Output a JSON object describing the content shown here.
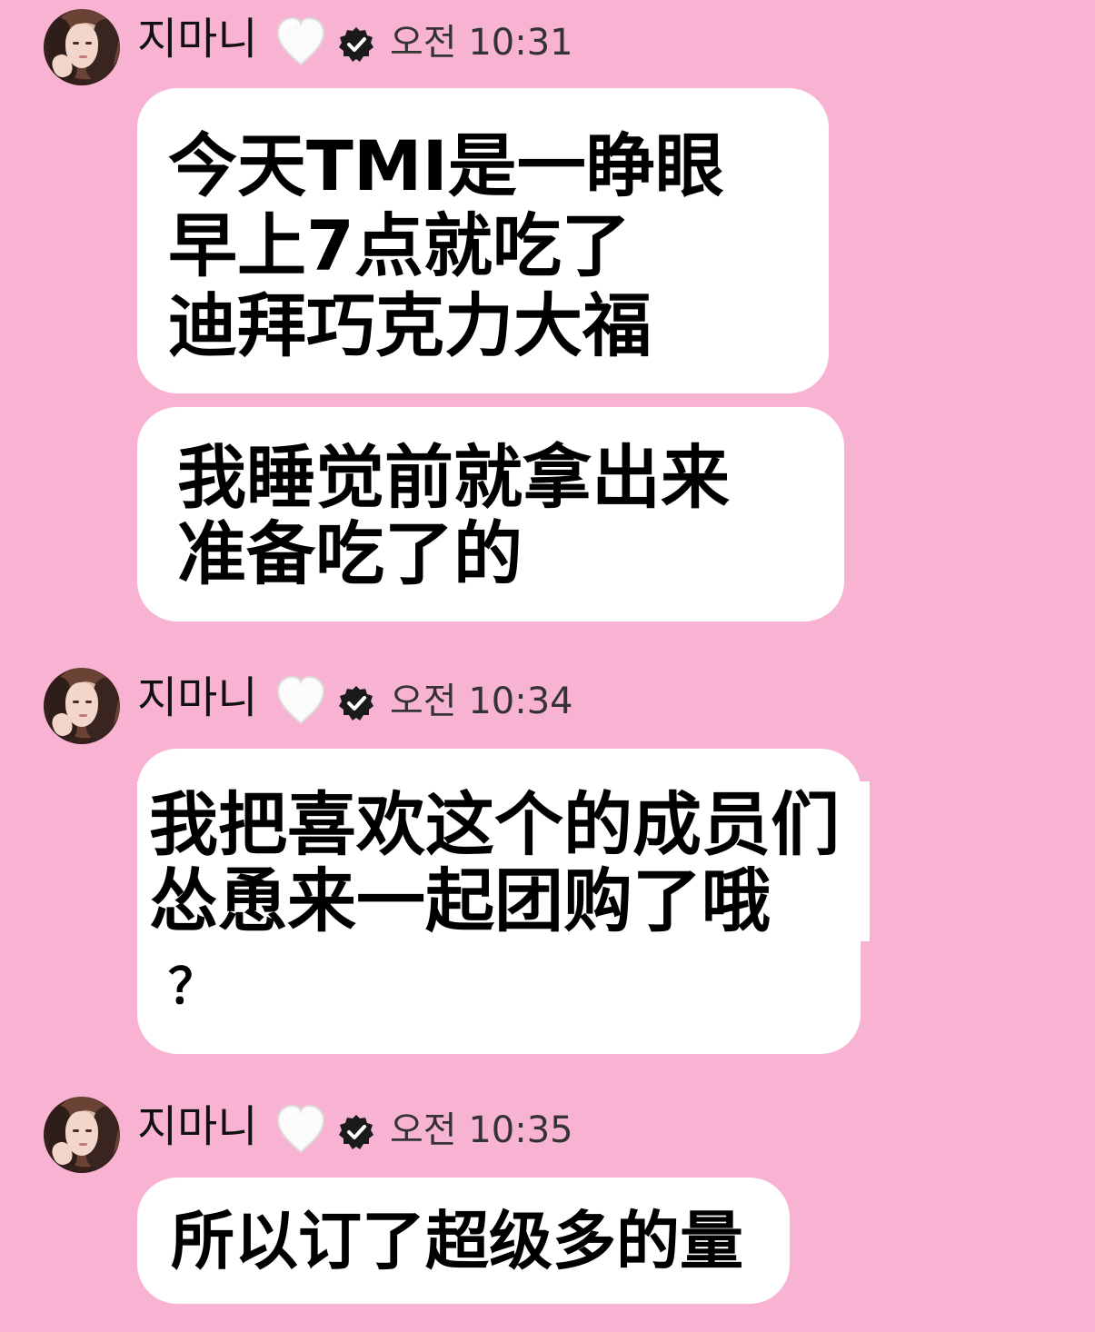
{
  "colors": {
    "background": "#f8b3d2",
    "bubble": "#ffffff",
    "text": "#111111",
    "timestamp": "#333333"
  },
  "messages": [
    {
      "sender": "지마니",
      "time": "오전 10:31",
      "icons": [
        "avatar",
        "white-heart-icon",
        "verified-badge-icon"
      ],
      "bubbles": [
        {
          "text": "今天TMI是一睁眼\n早上7点就吃了\n迪拜巧克力大福"
        },
        {
          "text": "我睡觉前就拿出来\n准备吃了的"
        }
      ]
    },
    {
      "sender": "지마니",
      "time": "오전 10:34",
      "icons": [
        "avatar",
        "white-heart-icon",
        "verified-badge-icon"
      ],
      "bubbles": [
        {
          "text": "我把喜欢这个的成员们\n怂恿来一起团购了哦",
          "tail": "？"
        }
      ]
    },
    {
      "sender": "지마니",
      "time": "오전 10:35",
      "icons": [
        "avatar",
        "white-heart-icon",
        "verified-badge-icon"
      ],
      "bubbles": [
        {
          "text": "所以订了超级多的量"
        }
      ]
    }
  ]
}
